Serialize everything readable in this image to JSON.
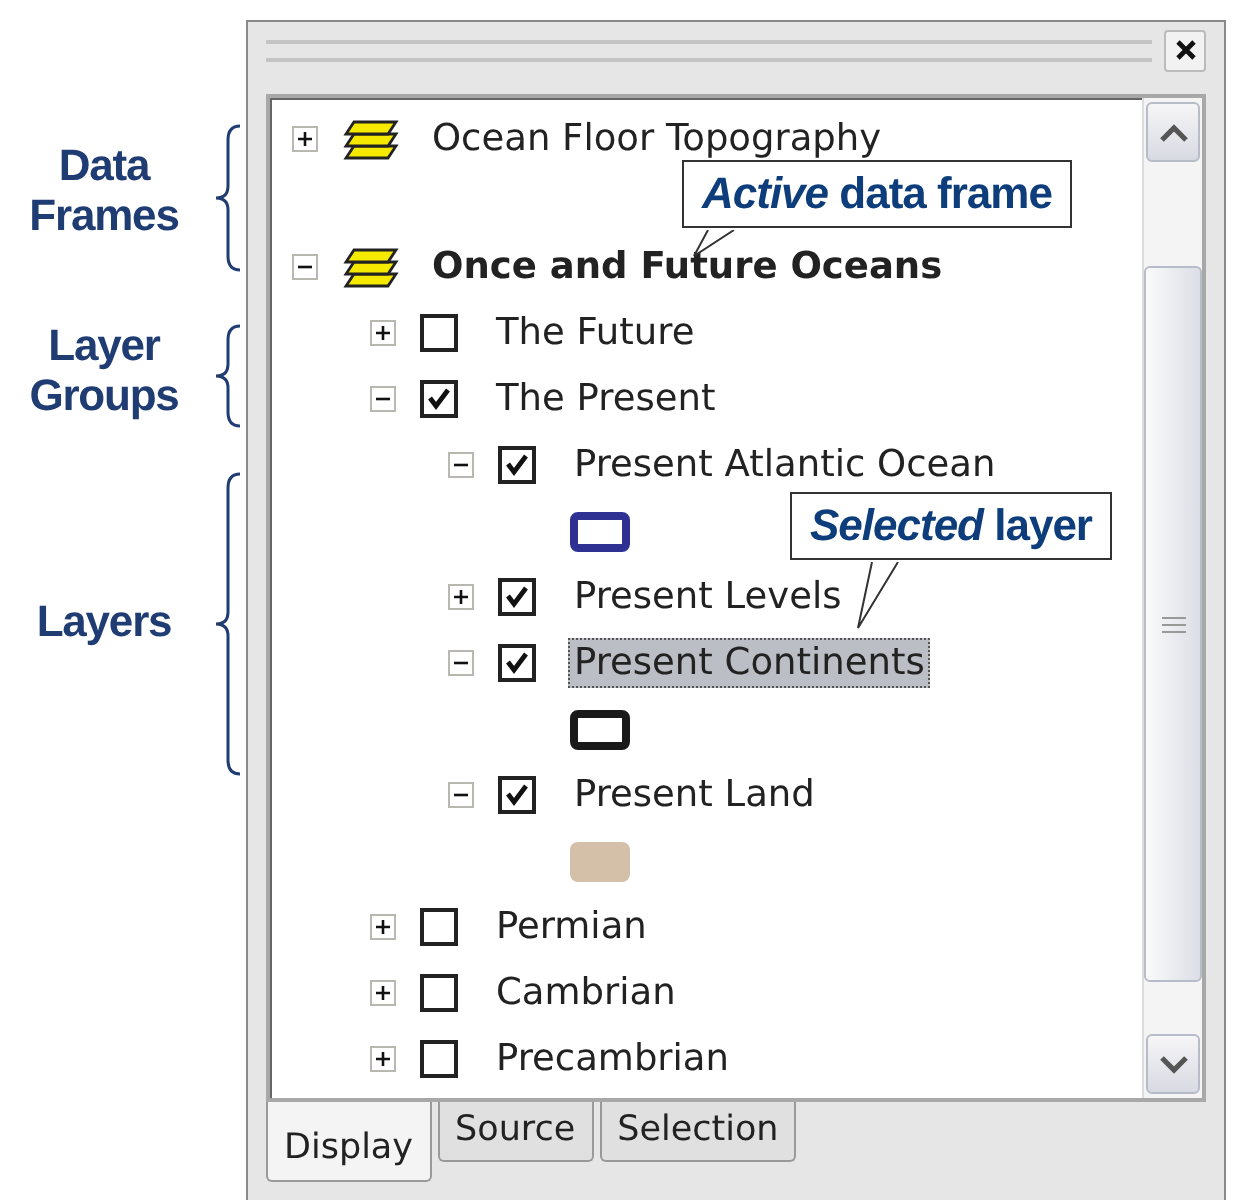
{
  "annotations": [
    {
      "text": "Data Frames"
    },
    {
      "text": "Layer Groups"
    },
    {
      "text": "Layers"
    }
  ],
  "callouts": [
    {
      "text": "*Active* data frame"
    },
    {
      "text": "*Selected* layer"
    }
  ],
  "panel": {
    "data_frames": [
      {
        "name": "Ocean Floor Topography",
        "expanded": false,
        "active": false
      },
      {
        "name": "Once and Future Oceans",
        "expanded": true,
        "active": true,
        "children": [
          {
            "name": "The Future",
            "expanded": false,
            "checked": false,
            "selected": false
          },
          {
            "name": "The Present",
            "expanded": true,
            "checked": true,
            "selected": false,
            "children": [
              {
                "name": "Present Atlantic Ocean",
                "expanded": true,
                "checked": true,
                "selected": false,
                "symbol": {
                  "kind": "outline",
                  "color": "#2e3192"
                }
              },
              {
                "name": "Present Levels",
                "expanded": false,
                "checked": true,
                "selected": false
              },
              {
                "name": "Present Continents",
                "expanded": true,
                "checked": true,
                "selected": true,
                "symbol": {
                  "kind": "outline",
                  "color": "#1a1a1a"
                }
              },
              {
                "name": "Present Land",
                "expanded": true,
                "checked": true,
                "selected": false,
                "symbol": {
                  "kind": "fill",
                  "color": "#d4bfa8"
                }
              }
            ]
          },
          {
            "name": "Permian",
            "expanded": false,
            "checked": false,
            "selected": false
          },
          {
            "name": "Cambrian",
            "expanded": false,
            "checked": false,
            "selected": false
          },
          {
            "name": "Precambrian",
            "expanded": false,
            "checked": false,
            "selected": false
          }
        ]
      }
    ],
    "tabs": [
      {
        "label": "Display",
        "selected": true
      },
      {
        "label": "Source",
        "selected": false
      },
      {
        "label": "Selection",
        "selected": false
      }
    ]
  }
}
